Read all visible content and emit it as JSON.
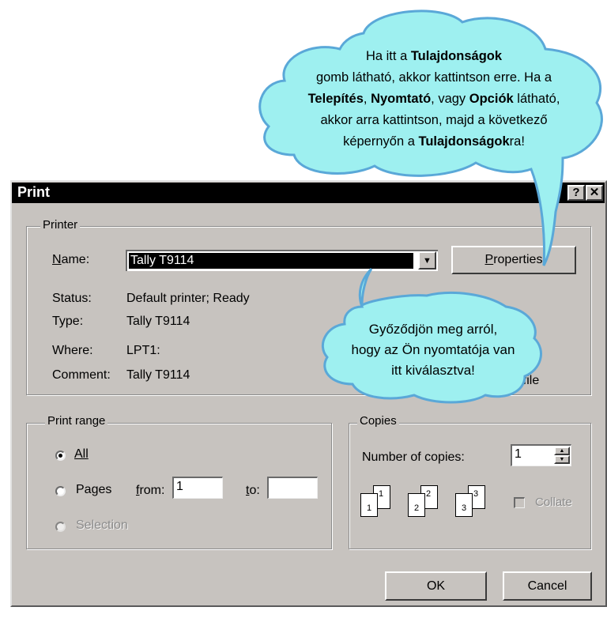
{
  "dialog": {
    "title": "Print",
    "help_button": "?",
    "close_button": "✕"
  },
  "printer": {
    "legend": "Printer",
    "name_label": "Name:",
    "name_value": "Tally T9114",
    "properties_button": "Properties",
    "status_label": "Status:",
    "status_value": "Default printer; Ready",
    "type_label": "Type:",
    "type_value": "Tally T9114",
    "where_label": "Where:",
    "where_value": "LPT1:",
    "comment_label": "Comment:",
    "comment_value": "Tally T9114",
    "print_to_file_label": "to file"
  },
  "print_range": {
    "legend": "Print range",
    "all_label": "All",
    "pages_label": "Pages",
    "from_label": "from:",
    "from_value": "1",
    "to_label": "to:",
    "to_value": "",
    "selection_label": "Selection"
  },
  "copies": {
    "legend": "Copies",
    "number_label": "Number of copies:",
    "number_value": "1",
    "collate_label": "Collate",
    "icon_pages": [
      "1",
      "1",
      "2",
      "2",
      "3",
      "3"
    ]
  },
  "footer": {
    "ok_button": "OK",
    "cancel_button": "Cancel"
  },
  "callouts": {
    "top": {
      "line1_prefix": "Ha itt a ",
      "line1_bold": "Tulajdonságok",
      "line2": "gomb látható, akkor kattintson erre. Ha a",
      "line3_bold1": "Telepítés",
      "line3_sep1": ", ",
      "line3_bold2": "Nyomtató",
      "line3_sep2": ", vagy ",
      "line3_bold3": "Opciók",
      "line3_suffix": " látható,",
      "line4": "akkor arra kattintson, majd a következő",
      "line5_prefix": "képernyőn a ",
      "line5_bold": "Tulajdonságok",
      "line5_suffix": "ra!"
    },
    "middle": {
      "line1": "Győződjön meg arról,",
      "line2": "hogy az Ön nyomtatója van",
      "line3": "itt kiválasztva!"
    }
  },
  "colors": {
    "dialog_bg": "#c7c3bf",
    "titlebar": "#000000",
    "bubble_fill": "#9ef0f0",
    "bubble_stroke": "#5aa8d8"
  }
}
